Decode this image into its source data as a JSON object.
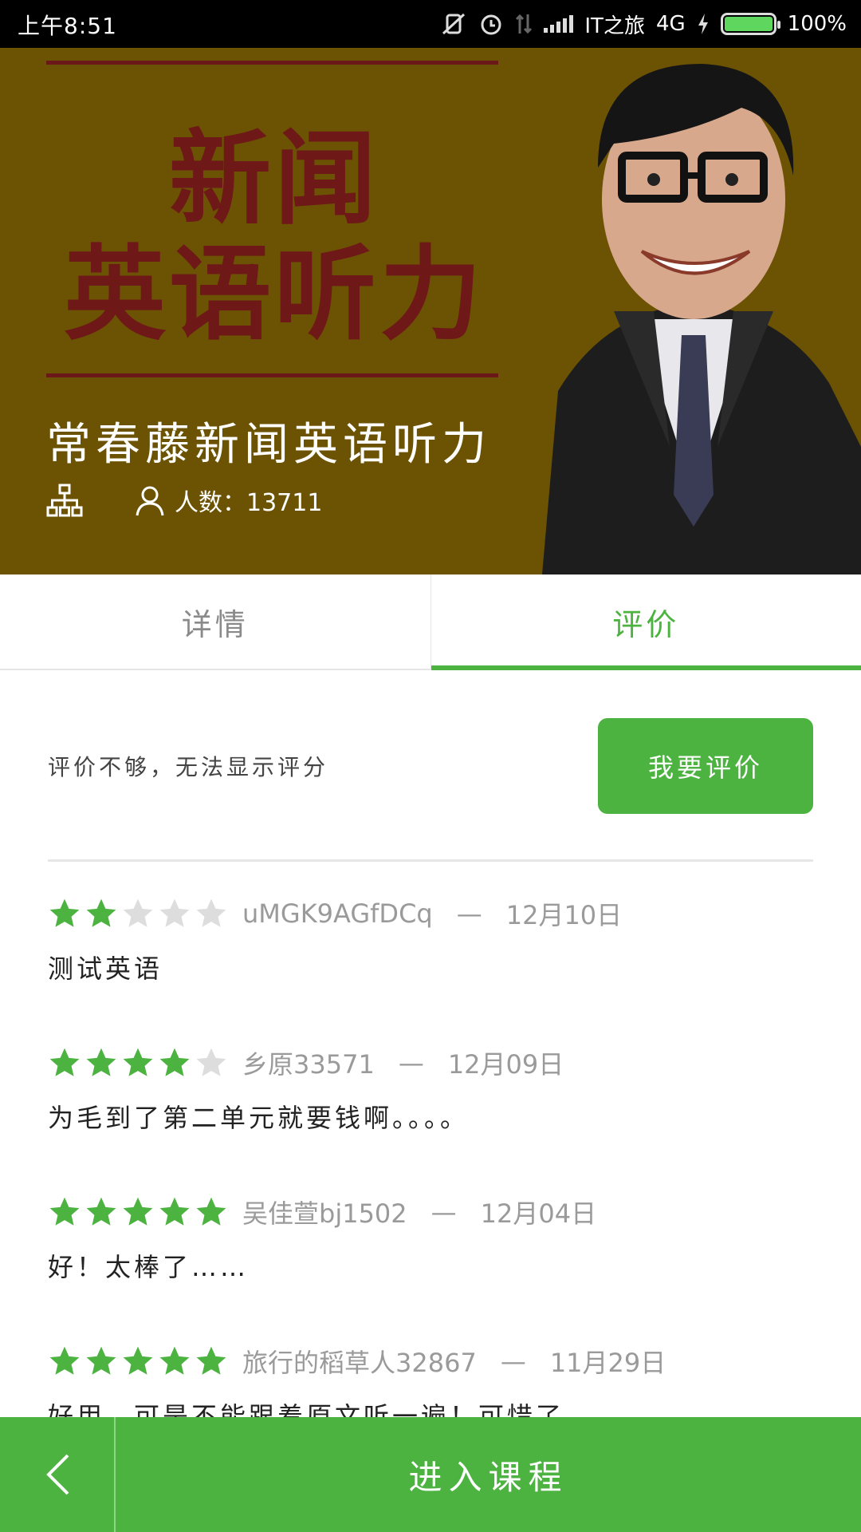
{
  "status_bar": {
    "time": "上午8:51",
    "carrier": "IT之旅",
    "network": "4G",
    "battery_text": "100%",
    "battery_level": 1.0
  },
  "banner": {
    "big_text_line1": "新闻",
    "big_text_line2": "英语听力",
    "course_title": "常春藤新闻英语听力",
    "count_label": "人数：13711"
  },
  "tabs": [
    {
      "label": "详情",
      "active": false
    },
    {
      "label": "评价",
      "active": true
    }
  ],
  "summary": {
    "text": "评价不够，无法显示评分",
    "button_label": "我要评价"
  },
  "reviews": [
    {
      "rating": 2,
      "reviewer": "uMGK9AGfDCq",
      "dash": "—",
      "date": "12月10日",
      "text": "测试英语"
    },
    {
      "rating": 4,
      "reviewer": "乡原33571",
      "dash": "—",
      "date": "12月09日",
      "text": "为毛到了第二单元就要钱啊。。。。"
    },
    {
      "rating": 5,
      "reviewer": "吴佳萱bj1502",
      "dash": "—",
      "date": "12月04日",
      "text": "好！太棒了……"
    },
    {
      "rating": 5,
      "reviewer": "旅行的稻草人32867",
      "dash": "—",
      "date": "11月29日",
      "text": "好用，可是不能跟着原文听一遍！可惜了"
    }
  ],
  "bottom_bar": {
    "enter_label": "进入课程"
  },
  "colors": {
    "accent": "#4cb240",
    "star_empty": "#dddddd",
    "banner_bg": "#6c5303"
  }
}
